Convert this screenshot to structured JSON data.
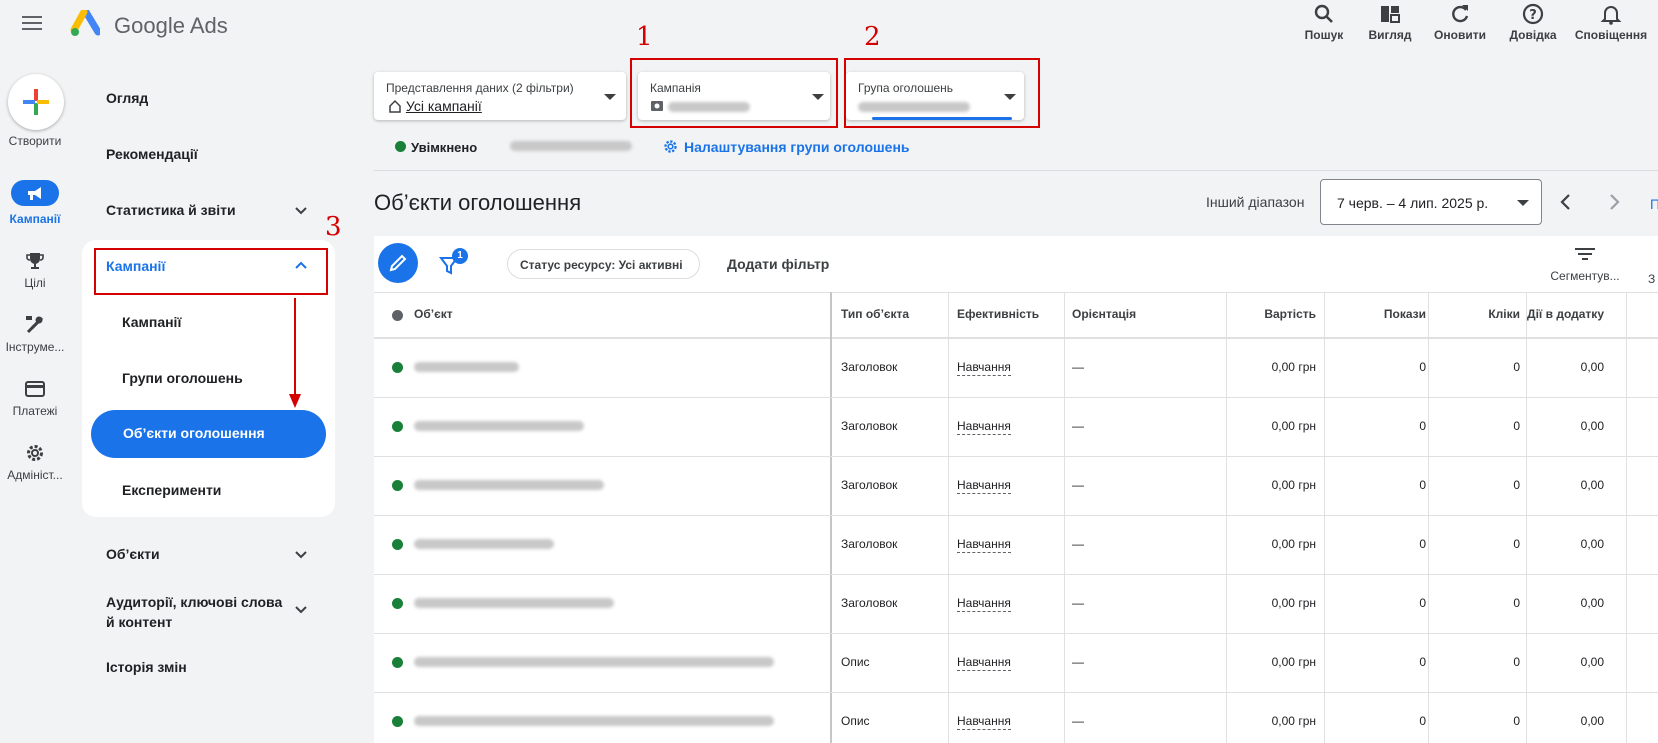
{
  "app": {
    "brand": "Google Ads"
  },
  "toolbar": [
    {
      "label": "Пошук",
      "icon": "search-icon"
    },
    {
      "label": "Вигляд",
      "icon": "appearance-icon"
    },
    {
      "label": "Оновити",
      "icon": "refresh-icon"
    },
    {
      "label": "Довідка",
      "icon": "help-icon"
    },
    {
      "label": "Сповіщення",
      "icon": "bell-icon"
    }
  ],
  "rail": {
    "create": "Створити",
    "campaigns": "Кампанії",
    "goals": "Цілі",
    "tools": "Інструме...",
    "billing": "Платежі",
    "admin": "Адмініст..."
  },
  "nav": {
    "overview": "Огляд",
    "recommendations": "Рекомендації",
    "stats": "Статистика й звіти",
    "campaigns": "Кампанії",
    "sub": [
      "Кампанії",
      "Групи оголошень",
      "Об’єкти оголошення",
      "Експерименти"
    ],
    "assets": "Об’єкти",
    "audiences": "Аудиторії, ключові слова й контент",
    "history": "Історія змін"
  },
  "filters": {
    "view_label": "Представлення даних (2 фільтри)",
    "view_value": "Усі кампанії",
    "campaign_label": "Кампанія",
    "adgroup_label": "Група оголошень",
    "status": "Увімкнено",
    "settings_link": "Налаштування групи оголошень"
  },
  "annotations": {
    "n1": "1",
    "n2": "2",
    "n3": "3"
  },
  "main": {
    "title": "Об’єкти оголошення",
    "range_label": "Інший діапазон",
    "range_value": "7 черв. – 4 лип. 2025 р.",
    "next_cut": "П",
    "filter_count": "1",
    "status_chip": "Статус ресурсу: Усі активні",
    "add_filter": "Додати фільтр",
    "segment": "Сегментув...",
    "cut_label": "З"
  },
  "table": {
    "headers": [
      "Об’єкт",
      "Тип об’єкта",
      "Ефективність",
      "Орієнтація",
      "Вартість",
      "Покази",
      "Кліки",
      "Дії в додатку"
    ],
    "rows": [
      {
        "type": "Заголовок",
        "perf": "Навчання",
        "orient": "—",
        "cost": "0,00 грн",
        "impr": "0",
        "clicks": "0",
        "actions": "0,00"
      },
      {
        "type": "Заголовок",
        "perf": "Навчання",
        "orient": "—",
        "cost": "0,00 грн",
        "impr": "0",
        "clicks": "0",
        "actions": "0,00"
      },
      {
        "type": "Заголовок",
        "perf": "Навчання",
        "orient": "—",
        "cost": "0,00 грн",
        "impr": "0",
        "clicks": "0",
        "actions": "0,00"
      },
      {
        "type": "Заголовок",
        "perf": "Навчання",
        "orient": "—",
        "cost": "0,00 грн",
        "impr": "0",
        "clicks": "0",
        "actions": "0,00"
      },
      {
        "type": "Заголовок",
        "perf": "Навчання",
        "orient": "—",
        "cost": "0,00 грн",
        "impr": "0",
        "clicks": "0",
        "actions": "0,00"
      },
      {
        "type": "Опис",
        "perf": "Навчання",
        "orient": "—",
        "cost": "0,00 грн",
        "impr": "0",
        "clicks": "0",
        "actions": "0,00"
      },
      {
        "type": "Опис",
        "perf": "Навчання",
        "orient": "—",
        "cost": "0,00 грн",
        "impr": "0",
        "clicks": "0",
        "actions": "0,00"
      }
    ]
  },
  "colors": {
    "accent": "#1a73e8",
    "annotation": "#d50000",
    "enabled": "#188038"
  }
}
